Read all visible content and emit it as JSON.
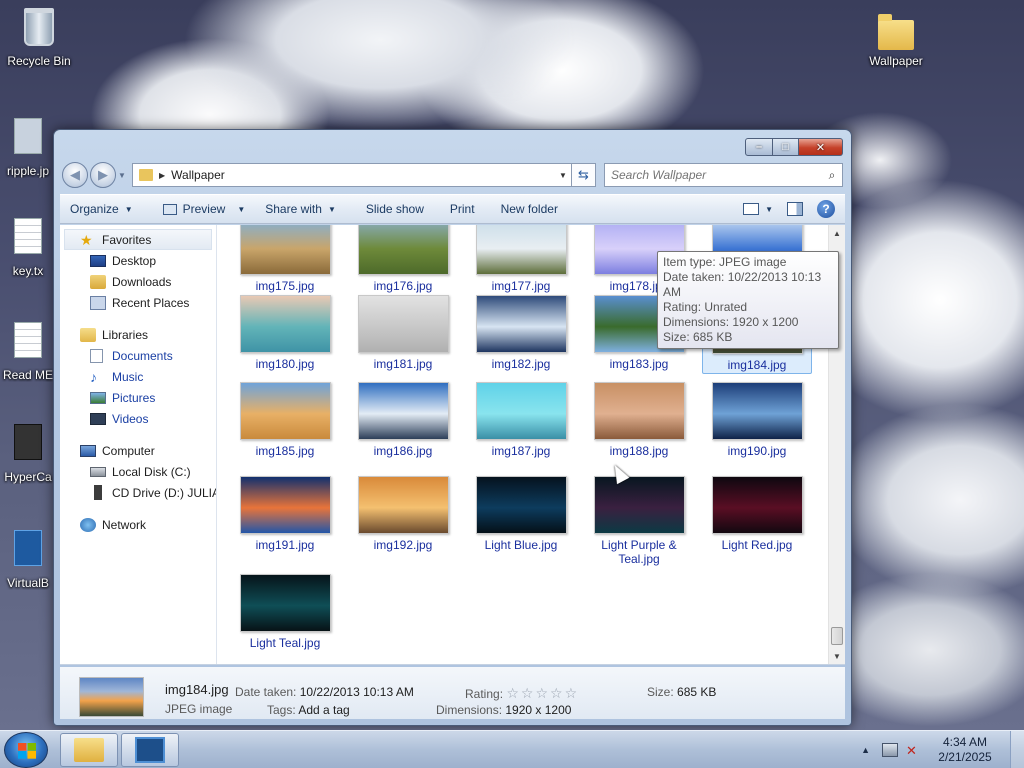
{
  "desktop": {
    "icons": [
      {
        "label": "Recycle Bin",
        "icon": "recycle-bin-icon"
      },
      {
        "label": "ripple.jp",
        "icon": "image-file-icon"
      },
      {
        "label": "key.tx",
        "icon": "text-file-icon"
      },
      {
        "label": "Read ME",
        "icon": "text-file-icon"
      },
      {
        "label": "HyperCa",
        "icon": "shortcut-icon"
      },
      {
        "label": "VirtualB",
        "icon": "virtualbox-icon"
      },
      {
        "label": "Wallpaper",
        "icon": "folder-icon"
      }
    ]
  },
  "window": {
    "controls": {
      "minimize": "–",
      "maximize": "□",
      "close": "✕"
    },
    "address": {
      "path": "Wallpaper"
    },
    "search": {
      "placeholder": "Search Wallpaper"
    },
    "toolbar": {
      "organize": "Organize",
      "preview": "Preview",
      "share_with": "Share with",
      "slide_show": "Slide show",
      "print": "Print",
      "new_folder": "New folder",
      "help": "?"
    }
  },
  "navpane": {
    "favorites": "Favorites",
    "desktop": "Desktop",
    "downloads": "Downloads",
    "recent": "Recent Places",
    "libraries": "Libraries",
    "documents": "Documents",
    "music": "Music",
    "pictures": "Pictures",
    "videos": "Videos",
    "computer": "Computer",
    "local_disk": "Local Disk (C:)",
    "cd_drive": "CD Drive (D:) JULIA",
    "network": "Network"
  },
  "files": [
    {
      "name": "img175.jpg",
      "colors": [
        "#7fb0d9",
        "#c9a56a",
        "#8a6a3a"
      ]
    },
    {
      "name": "img176.jpg",
      "colors": [
        "#8db0c8",
        "#6e8a3a",
        "#4d6a2a"
      ]
    },
    {
      "name": "img177.jpg",
      "colors": [
        "#c8dce8",
        "#e8eef2",
        "#5e6e3a"
      ]
    },
    {
      "name": "img178.jpg",
      "colors": [
        "#a9a9f2",
        "#d8d0fa",
        "#7c7ee0"
      ]
    },
    {
      "name": "img179.jpg",
      "colors": [
        "#c9dcf4",
        "#3e76d4",
        "#1b3f9a"
      ]
    },
    {
      "name": "img180.jpg",
      "colors": [
        "#e9c9b4",
        "#62b4b8",
        "#3f93a6"
      ]
    },
    {
      "name": "img181.jpg",
      "colors": [
        "#e2e2e2",
        "#c8c8c8",
        "#b0b0b0"
      ]
    },
    {
      "name": "img182.jpg",
      "colors": [
        "#2e4a7a",
        "#d7e4f2",
        "#1e3560"
      ]
    },
    {
      "name": "img183.jpg",
      "colors": [
        "#5a8fd0",
        "#3a6b2c",
        "#7fb0e0"
      ]
    },
    {
      "name": "img184.jpg",
      "colors": [
        "#5e86c4",
        "#f3a24a",
        "#3a4a36"
      ]
    },
    {
      "name": "img185.jpg",
      "colors": [
        "#6fa3d9",
        "#e8b066",
        "#c98a3c"
      ]
    },
    {
      "name": "img186.jpg",
      "colors": [
        "#2f6ec0",
        "#e3ecf5",
        "#2c3e58"
      ]
    },
    {
      "name": "img187.jpg",
      "colors": [
        "#5fd2e8",
        "#89e4ee",
        "#3a8fa6"
      ]
    },
    {
      "name": "img188.jpg",
      "colors": [
        "#c89064",
        "#e0b090",
        "#8a5a3a"
      ]
    },
    {
      "name": "img190.jpg",
      "colors": [
        "#1c3d78",
        "#6fa2d6",
        "#0e2248"
      ]
    },
    {
      "name": "img191.jpg",
      "colors": [
        "#12306e",
        "#e8743a",
        "#2356a8"
      ]
    },
    {
      "name": "img192.jpg",
      "colors": [
        "#d98a3a",
        "#f4c070",
        "#6a4a2e"
      ]
    },
    {
      "name": "Light Blue.jpg",
      "colors": [
        "#05121e",
        "#0d3c5e",
        "#041018"
      ]
    },
    {
      "name": "Light Purple & Teal.jpg",
      "colors": [
        "#081620",
        "#3a2040",
        "#0c3a44"
      ]
    },
    {
      "name": "Light Red.jpg",
      "colors": [
        "#0e0810",
        "#5a0e24",
        "#120810"
      ]
    },
    {
      "name": "Light Teal.jpg",
      "colors": [
        "#06141a",
        "#0f4e56",
        "#071216"
      ]
    }
  ],
  "tooltip": {
    "type": "Item type: JPEG image",
    "date": "Date taken: 10/22/2013 10:13 AM",
    "rating": "Rating: Unrated",
    "dimensions": "Dimensions: 1920 x 1200",
    "size": "Size: 685 KB"
  },
  "details": {
    "name": "img184.jpg",
    "type": "JPEG image",
    "date_label": "Date taken:",
    "date_value": "10/22/2013 10:13 AM",
    "tags_label": "Tags:",
    "tags_value": "Add a tag",
    "rating_label": "Rating:",
    "rating_stars": "☆☆☆☆☆",
    "dimensions_label": "Dimensions:",
    "dimensions_value": "1920 x 1200",
    "size_label": "Size:",
    "size_value": "685 KB"
  },
  "taskbar": {
    "time": "4:34 AM",
    "date": "2/21/2025"
  }
}
